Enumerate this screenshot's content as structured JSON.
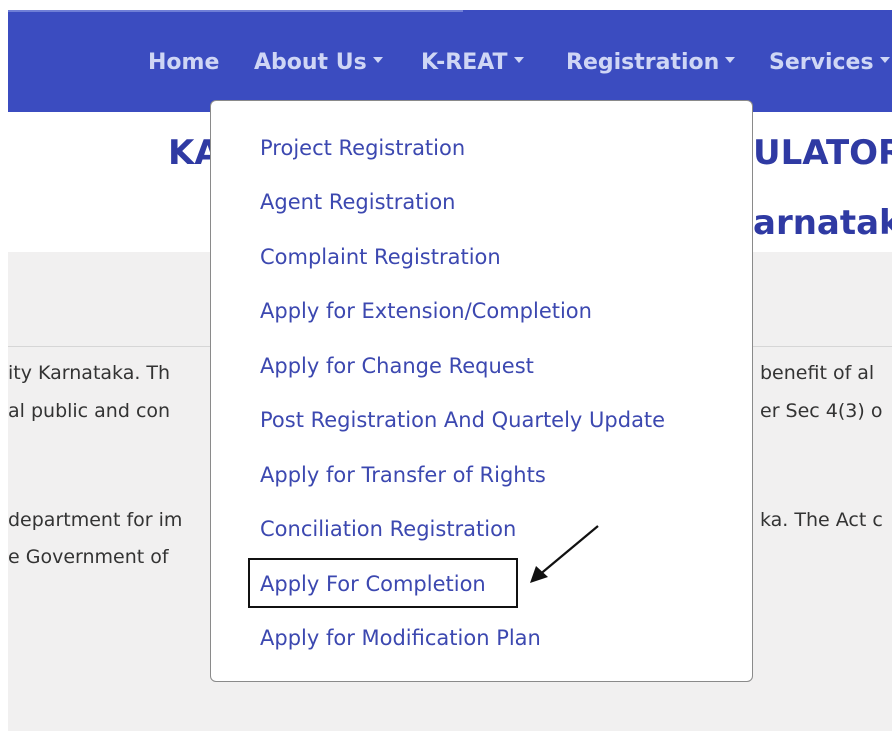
{
  "nav": {
    "items": [
      {
        "label": "Home",
        "has_caret": false
      },
      {
        "label": "About Us",
        "has_caret": true
      },
      {
        "label": "K-REAT",
        "has_caret": true
      },
      {
        "label": "Registration",
        "has_caret": true
      },
      {
        "label": "Services",
        "has_caret": true
      }
    ]
  },
  "title": {
    "line1_left": "KA",
    "line1_right": "ULATOR",
    "line2_right": "arnataka"
  },
  "body_text": {
    "p1_l1_left": "ity Karnataka. Th",
    "p1_l1_right": "benefit of al",
    "p1_l2_left": "al public and con",
    "p1_l2_right": "er Sec 4(3) o",
    "p2_l1_left": "department for im",
    "p2_l1_right": "ka. The Act c",
    "p2_l2_left": "e Government of "
  },
  "dropdown": {
    "items": [
      "Project Registration",
      "Agent Registration",
      "Complaint Registration",
      "Apply for Extension/Completion",
      "Apply for Change Request",
      "Post Registration And Quartely Update",
      "Apply for Transfer of Rights",
      "Conciliation Registration",
      "Apply For Completion",
      "Apply for Modification Plan"
    ],
    "highlighted_index": 8
  },
  "colors": {
    "nav_bg": "#3b4cc0",
    "nav_text": "#cfd6f5",
    "title": "#2f3aa3",
    "dropdown_link": "#3c48b0",
    "content_bg": "#f1f0f0"
  }
}
